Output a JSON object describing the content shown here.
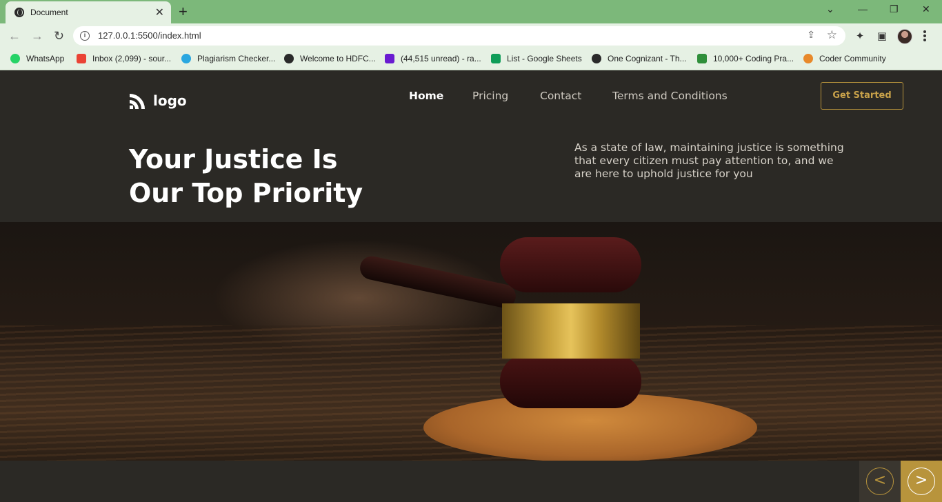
{
  "browser": {
    "tab_title": "Document",
    "tab_close": "✕",
    "new_tab": "+",
    "url": "127.0.0.1:5500/index.html",
    "window_controls": {
      "chevron": "⌄",
      "minimize": "—",
      "restore": "❐",
      "close": "✕"
    },
    "nav": {
      "back": "←",
      "forward": "→",
      "reload": "↻"
    },
    "bookmarks": [
      {
        "label": "WhatsApp",
        "icon": "whatsapp-icon",
        "color": "#25d366"
      },
      {
        "label": "Inbox (2,099) - sour...",
        "icon": "gmail-icon",
        "color": "#ea4335"
      },
      {
        "label": "Plagiarism Checker...",
        "icon": "checker-icon",
        "color": "#2aa7e0"
      },
      {
        "label": "Welcome to HDFC...",
        "icon": "globe-icon",
        "color": "#2a2a2a"
      },
      {
        "label": "(44,515 unread) - ra...",
        "icon": "mail-icon",
        "color": "#6a1bd1"
      },
      {
        "label": "List - Google Sheets",
        "icon": "sheets-icon",
        "color": "#0f9d58"
      },
      {
        "label": "One Cognizant - Th...",
        "icon": "globe-icon",
        "color": "#2a2a2a"
      },
      {
        "label": "10,000+ Coding Pra...",
        "icon": "coding-icon",
        "color": "#2f8f3a"
      },
      {
        "label": "Coder Community",
        "icon": "code-icon",
        "color": "#e8892a"
      }
    ]
  },
  "site": {
    "logo_text": "logo",
    "nav": [
      {
        "label": "Home",
        "active": true
      },
      {
        "label": "Pricing",
        "active": false
      },
      {
        "label": "Contact",
        "active": false
      },
      {
        "label": "Terms and Conditions",
        "active": false
      }
    ],
    "cta_label": "Get Started",
    "hero": {
      "title_line1": "Your Justice Is",
      "title_line2": "Our Top Priority",
      "description": "As a state of law, maintaining justice is something that every citizen must pay attention to, and we are here to uphold justice for you"
    },
    "pager": {
      "prev": "<",
      "next": ">"
    },
    "colors": {
      "background": "#2b2925",
      "accent": "#b8943c"
    }
  }
}
